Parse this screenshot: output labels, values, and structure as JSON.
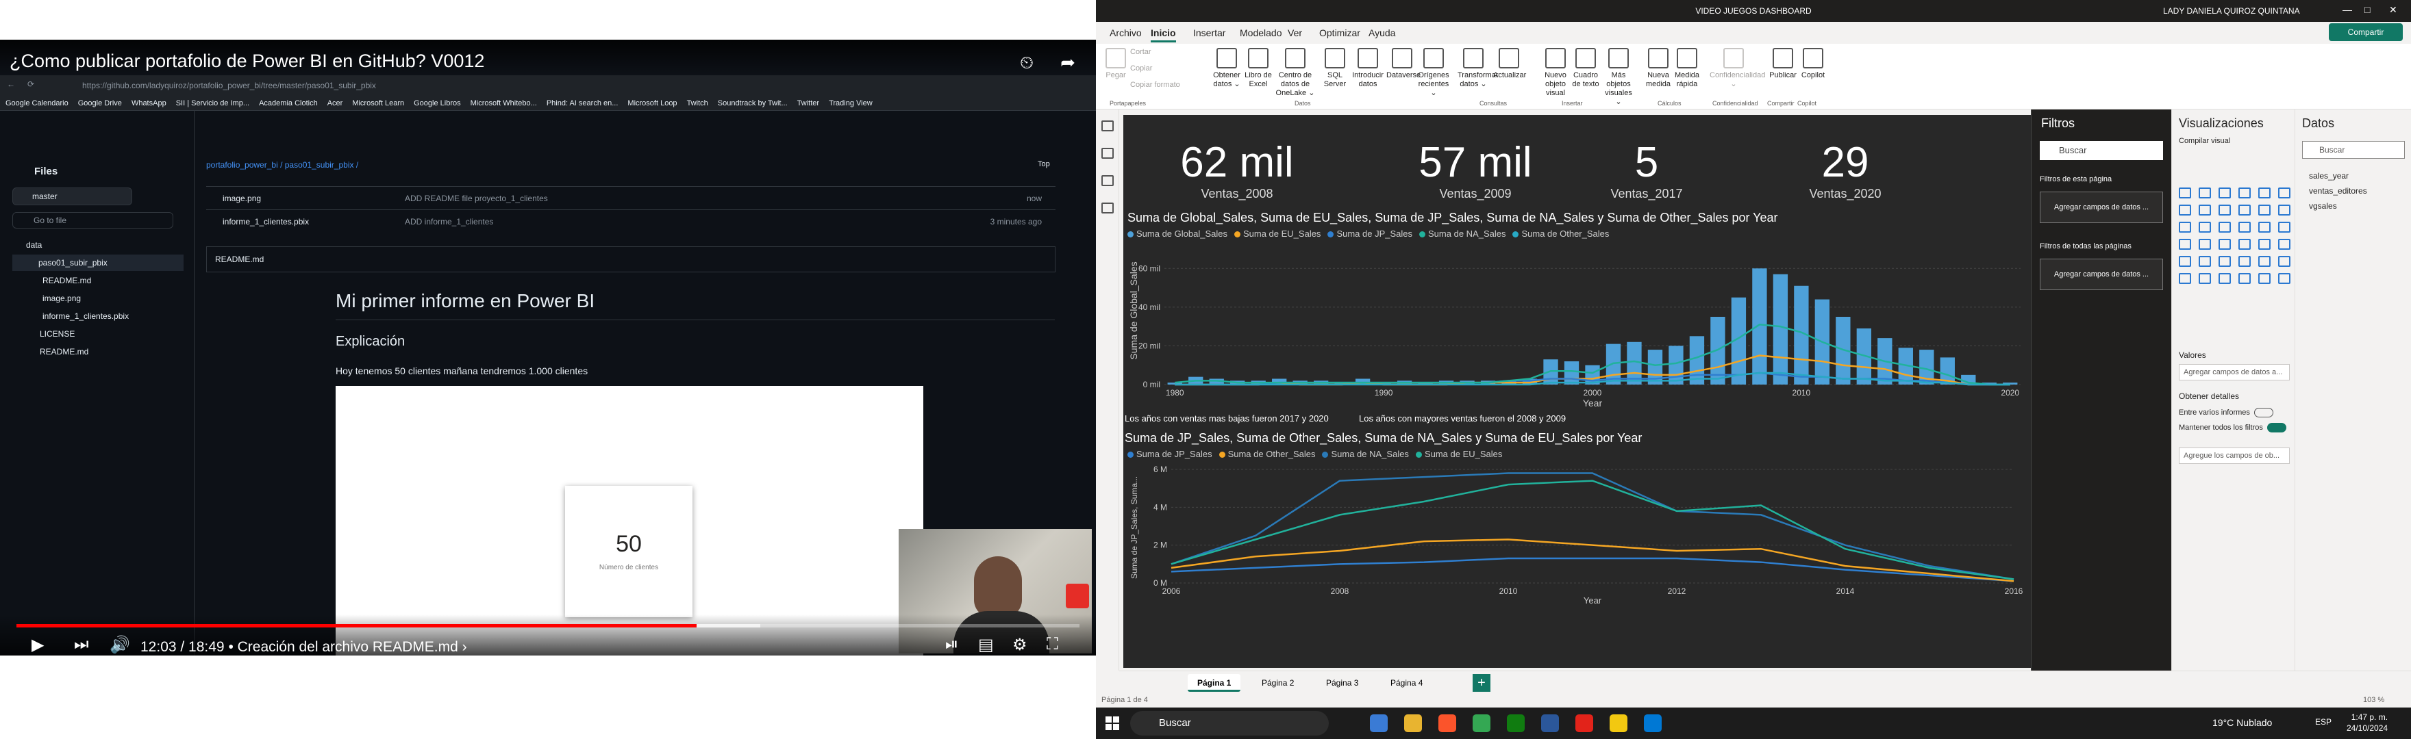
{
  "video": {
    "title": "¿Como publicar portafolio de Power BI en GitHub? V0012",
    "url": "https://github.com/ladyquiroz/portafolio_power_bi/tree/master/paso01_subir_pbix",
    "time": "12:03 / 18:49 • Creación del archivo README.md ›",
    "progress": 0.64,
    "buffer": 0.7,
    "bookmarks": [
      "Google Calendario",
      "Google Drive",
      "WhatsApp",
      "SII | Servicio de Imp...",
      "Academia Clotich",
      "Acer",
      "Microsoft Learn",
      "Google Libros",
      "Microsoft Whitebo...",
      "Phind: AI search en...",
      "Microsoft Loop",
      "Twitch",
      "Soundtrack by Twit...",
      "Twitter",
      "Trading View"
    ]
  },
  "github": {
    "files_title": "Files",
    "branch": "master",
    "goto": "Go to file",
    "tree": [
      "data",
      "paso01_subir_pbix",
      "README.md",
      "image.png",
      "informe_1_clientes.pbix",
      "LICENSE",
      "README.md"
    ],
    "breadcrumb": "portafolio_power_bi / paso01_subir_pbix /",
    "top": "Top",
    "rows": [
      {
        "name": "image.png",
        "commit": "ADD README file proyecto_1_clientes",
        "time": "now"
      },
      {
        "name": "informe_1_clientes.pbix",
        "commit": "ADD informe_1_clientes",
        "time": "3 minutes ago"
      }
    ],
    "readme_label": "README.md",
    "h1": "Mi primer informe en Power BI",
    "h2": "Explicación",
    "p": "Hoy tenemos 50 clientes mañana tendremos 1.000 clientes",
    "card_value": "50",
    "card_label": "Número de clientes"
  },
  "pbi": {
    "title": "VIDEO JUEGOS DASHBOARD",
    "user": "LADY DANIELA QUIROZ QUINTANA",
    "share": "Compartir",
    "menus": [
      "Archivo",
      "Inicio",
      "Insertar",
      "Modelado",
      "Ver",
      "Optimizar",
      "Ayuda"
    ],
    "ribbon": [
      {
        "l": "Pegar",
        "d": true
      },
      {
        "l": "Obtener datos ⌄"
      },
      {
        "l": "Libro de Excel"
      },
      {
        "l": "Centro de datos de OneLake ⌄"
      },
      {
        "l": "SQL Server"
      },
      {
        "l": "Introducir datos"
      },
      {
        "l": "Dataverse"
      },
      {
        "l": "Orígenes recientes ⌄"
      },
      {
        "l": "Transformar datos ⌄"
      },
      {
        "l": "Actualizar"
      },
      {
        "l": "Nuevo objeto visual"
      },
      {
        "l": "Cuadro de texto"
      },
      {
        "l": "Más objetos visuales ⌄"
      },
      {
        "l": "Nueva medida"
      },
      {
        "l": "Medida rápida"
      },
      {
        "l": "Confidencialidad ⌄",
        "d": true
      },
      {
        "l": "Publicar"
      },
      {
        "l": "Copilot"
      }
    ],
    "ribbon_small": [
      "Cortar",
      "Copiar",
      "Copiar formato"
    ],
    "groups": [
      "Portapapeles",
      "Datos",
      "Consultas",
      "Insertar",
      "Cálculos",
      "Confidencialidad",
      "Compartir",
      "Copilot"
    ],
    "kpis": [
      {
        "v": "62 mil",
        "l": "Ventas_2008"
      },
      {
        "v": "57 mil",
        "l": "Ventas_2009"
      },
      {
        "v": "5",
        "l": "Ventas_2017"
      },
      {
        "v": "29",
        "l": "Ventas_2020"
      }
    ],
    "note1": "Los años con ventas mas bajas fueron 2017 y 2020",
    "note2": "Los años con mayores ventas fueron el 2008 y 2009",
    "pages": [
      "Página 1",
      "Página 2",
      "Página 3",
      "Página 4"
    ],
    "status": "Página 1 de 4",
    "zoom": "103 %",
    "filters": {
      "title": "Filtros",
      "search": "Buscar",
      "page": "Filtros de esta página",
      "all": "Filtros de todas las páginas",
      "add": "Agregar campos de datos ..."
    },
    "viz": {
      "title": "Visualizaciones",
      "build": "Compilar visual",
      "values": "Valores",
      "add": "Agregar campos de datos a...",
      "drill": "Obtener detalles",
      "cross": "Entre varios informes",
      "keep": "Mantener todos los filtros",
      "add2": "Agregue los campos de ob..."
    },
    "data": {
      "title": "Datos",
      "search": "Buscar",
      "tables": [
        "sales_year",
        "ventas_editores",
        "vgsales"
      ]
    }
  },
  "taskbar": {
    "search": "Buscar",
    "weather": "19°C Nublado",
    "lang": "ESP",
    "time": "1:47 p. m.",
    "date": "24/10/2024"
  },
  "colors": {
    "global": "#4ea1d9",
    "eu": "#f5a623",
    "jp": "#2f7fd0",
    "na": "#21b29c",
    "other": "#28a9c4"
  },
  "chart_data": [
    {
      "type": "bar",
      "title": "Suma de Global_Sales, Suma de EU_Sales, Suma de JP_Sales, Suma de NA_Sales y Suma de Other_Sales por Year",
      "xlabel": "Year",
      "ylabel": "Suma de Global_Sales",
      "ylim": [
        0,
        70
      ],
      "legend": "top-left",
      "x": [
        1980,
        1981,
        1982,
        1983,
        1984,
        1985,
        1986,
        1987,
        1988,
        1989,
        1990,
        1991,
        1992,
        1993,
        1994,
        1995,
        1996,
        1997,
        1998,
        1999,
        2000,
        2001,
        2002,
        2003,
        2004,
        2005,
        2006,
        2007,
        2008,
        2009,
        2010,
        2011,
        2012,
        2013,
        2014,
        2015,
        2016,
        2017,
        2018,
        2019,
        2020
      ],
      "series": [
        {
          "name": "Suma de Global_Sales",
          "kind": "bar",
          "values": [
            1,
            4,
            3,
            2,
            2,
            3,
            2,
            2,
            1,
            3,
            1,
            2,
            1,
            2,
            2,
            2,
            2,
            3,
            13,
            12,
            10,
            21,
            22,
            18,
            20,
            25,
            35,
            45,
            60,
            57,
            51,
            44,
            35,
            29,
            24,
            19,
            18,
            14,
            5,
            1,
            1
          ]
        },
        {
          "name": "Suma de EU_Sales",
          "kind": "line",
          "values": [
            0,
            0,
            0,
            0,
            0,
            1,
            0,
            0,
            0,
            1,
            0,
            0,
            0,
            0,
            1,
            1,
            1,
            1,
            3,
            3,
            3,
            5,
            6,
            5,
            5,
            7,
            9,
            12,
            15,
            14,
            13,
            12,
            10,
            9,
            8,
            5,
            3,
            2,
            0,
            0,
            0
          ]
        },
        {
          "name": "Suma de JP_Sales",
          "kind": "line",
          "values": [
            0,
            0,
            0,
            0,
            0,
            1,
            1,
            1,
            1,
            1,
            1,
            1,
            1,
            1,
            1,
            1,
            2,
            2,
            3,
            3,
            2,
            3,
            3,
            3,
            4,
            5,
            5,
            5,
            6,
            5,
            4,
            4,
            3,
            3,
            3,
            2,
            2,
            1,
            0,
            0,
            0
          ]
        },
        {
          "name": "Suma de NA_Sales",
          "kind": "line",
          "values": [
            1,
            2,
            2,
            1,
            1,
            1,
            1,
            1,
            1,
            1,
            1,
            1,
            1,
            1,
            1,
            1,
            2,
            3,
            7,
            7,
            6,
            11,
            12,
            10,
            11,
            14,
            18,
            24,
            31,
            30,
            27,
            22,
            18,
            15,
            12,
            10,
            8,
            5,
            1,
            0,
            0
          ]
        },
        {
          "name": "Suma de Other_Sales",
          "kind": "line",
          "values": [
            0,
            0,
            0,
            0,
            0,
            0,
            0,
            0,
            0,
            0,
            0,
            0,
            0,
            0,
            0,
            0,
            0,
            0,
            1,
            1,
            1,
            2,
            2,
            2,
            2,
            3,
            3,
            5,
            6,
            6,
            5,
            4,
            3,
            3,
            2,
            2,
            1,
            1,
            0,
            0,
            0
          ]
        }
      ]
    },
    {
      "type": "line",
      "title": "Suma de JP_Sales, Suma de Other_Sales, Suma de NA_Sales y Suma de EU_Sales por Year",
      "xlabel": "Year",
      "ylabel": "Suma de JP_Sales, Suma...",
      "ylim": [
        0,
        6
      ],
      "legend": "top-left",
      "x": [
        2006,
        2007,
        2008,
        2009,
        2010,
        2011,
        2012,
        2013,
        2014,
        2015,
        2016
      ],
      "series": [
        {
          "name": "Suma de JP_Sales",
          "values": [
            0.6,
            0.8,
            1.0,
            1.1,
            1.3,
            1.3,
            1.3,
            1.1,
            0.7,
            0.4,
            0.1
          ]
        },
        {
          "name": "Suma de Other_Sales",
          "values": [
            0.8,
            1.4,
            1.7,
            2.2,
            2.3,
            2.0,
            1.7,
            1.8,
            0.9,
            0.5,
            0.1
          ]
        },
        {
          "name": "Suma de NA_Sales",
          "values": [
            1.0,
            2.5,
            5.4,
            5.6,
            5.8,
            5.8,
            3.8,
            3.6,
            2.0,
            0.9,
            0.2
          ]
        },
        {
          "name": "Suma de EU_Sales",
          "values": [
            1.0,
            2.3,
            3.6,
            4.3,
            5.2,
            5.4,
            3.8,
            4.1,
            1.8,
            0.8,
            0.2
          ]
        }
      ]
    }
  ]
}
